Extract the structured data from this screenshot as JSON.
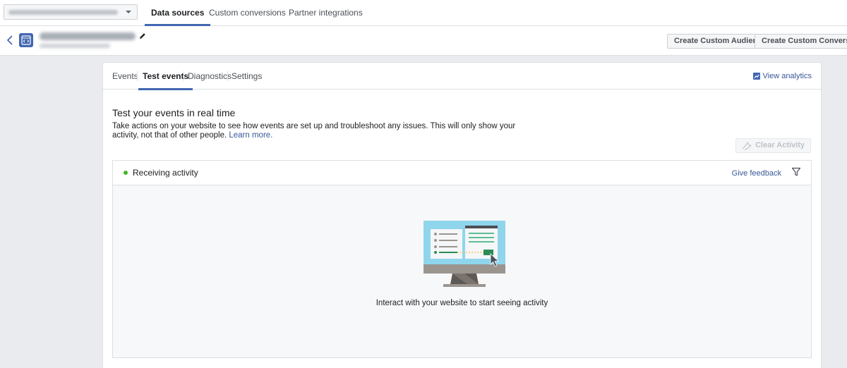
{
  "top_nav": {
    "tabs": [
      {
        "label": "Data sources",
        "active": true
      },
      {
        "label": "Custom conversions",
        "active": false
      },
      {
        "label": "Partner integrations",
        "active": false
      }
    ]
  },
  "header": {
    "create_audience_label": "Create Custom Audience",
    "create_conversion_label": "Create Custom Conversion"
  },
  "card": {
    "tabs": [
      {
        "label": "Events",
        "active": false
      },
      {
        "label": "Test events",
        "active": true
      },
      {
        "label": "Diagnostics",
        "active": false
      },
      {
        "label": "Settings",
        "active": false
      }
    ],
    "view_analytics": "View analytics",
    "title": "Test your events in real time",
    "description": "Take actions on your website to see how events are set up and troubleshoot any issues. This will only show your activity, not that of other people.",
    "learn_more": "Learn more.",
    "clear_activity": "Clear Activity",
    "activity": {
      "status": "Receiving activity",
      "give_feedback": "Give feedback",
      "empty_message": "Interact with your website to start seeing activity"
    }
  },
  "colors": {
    "accent": "#4267b2",
    "link": "#365899",
    "status_green": "#42b72a",
    "page_bg": "#e9ebee"
  },
  "icons": [
    "chevron-left-icon",
    "pixel-code-icon",
    "pencil-icon",
    "analytics-icon",
    "megaphone-icon",
    "filter-icon",
    "dropdown-caret-icon"
  ]
}
